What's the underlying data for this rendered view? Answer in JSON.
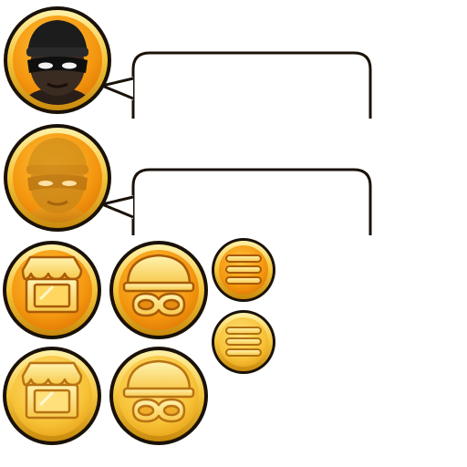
{
  "sprite_sheet": {
    "portraits": [
      {
        "name": "thief-portrait",
        "state": "normal"
      },
      {
        "name": "thief-portrait",
        "state": "disabled"
      }
    ],
    "speech_bubbles": [
      {
        "name": "speech-bubble",
        "text": ""
      },
      {
        "name": "speech-bubble",
        "text": ""
      }
    ],
    "buttons": [
      {
        "icon": "shop-icon",
        "state": "normal"
      },
      {
        "icon": "thief-mask-icon",
        "state": "normal"
      },
      {
        "icon": "menu-icon",
        "state": "normal"
      },
      {
        "icon": "menu-icon",
        "state": "pressed"
      },
      {
        "icon": "shop-icon",
        "state": "pressed"
      },
      {
        "icon": "thief-mask-icon",
        "state": "pressed"
      }
    ],
    "colors": {
      "coin_outline": "#1a1208",
      "coin_rim": "#f3c238",
      "coin_face": "#f29a12",
      "coin_face_light": "#ffd25a",
      "icon_fill": "#ffe27a",
      "icon_stroke": "#a85a08",
      "portrait_skin": "#3b2c22",
      "mask_black": "#111111"
    }
  }
}
